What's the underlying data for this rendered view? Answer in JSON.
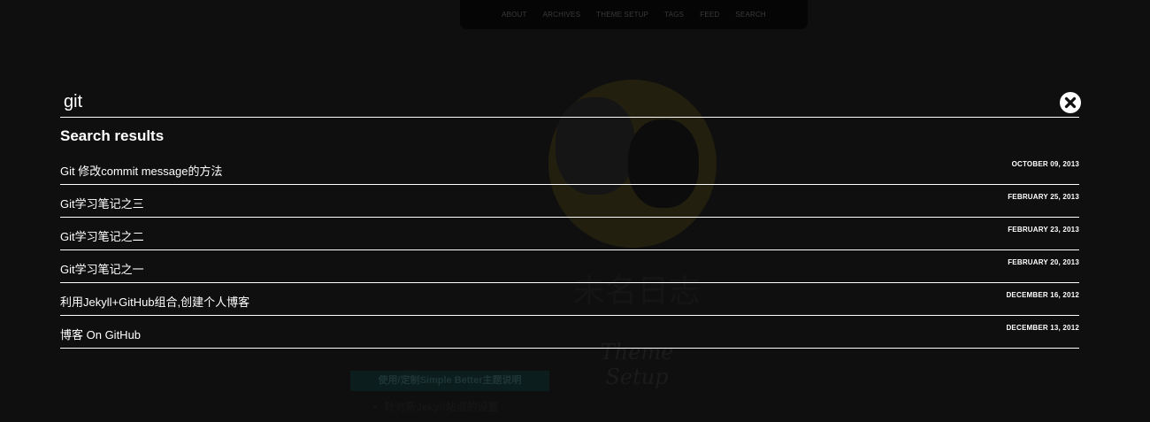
{
  "nav": {
    "items": [
      "ABOUT",
      "ARCHIVES",
      "THEME SETUP",
      "TAGS",
      "FEED",
      "SEARCH"
    ]
  },
  "search": {
    "query": "git",
    "results_heading": "Search results",
    "results": [
      {
        "title": "Git 修改commit message的方法",
        "date": "OCTOBER 09, 2013"
      },
      {
        "title": "Git学习笔记之三",
        "date": "FEBRUARY 25, 2013"
      },
      {
        "title": "Git学习笔记之二",
        "date": "FEBRUARY 23, 2013"
      },
      {
        "title": "Git学习笔记之一",
        "date": "FEBRUARY 20, 2013"
      },
      {
        "title": "利用Jekyll+GitHub组合,创建个人博客",
        "date": "DECEMBER 16, 2012"
      },
      {
        "title": "博客 On GitHub",
        "date": "DECEMBER 13, 2012"
      }
    ]
  },
  "background": {
    "site_title": "未名日志",
    "theme_heading": "Theme Setup",
    "badge": "使用/定制Simple Better主题说明",
    "bullet": "针对新Jekyll站点的设置"
  }
}
